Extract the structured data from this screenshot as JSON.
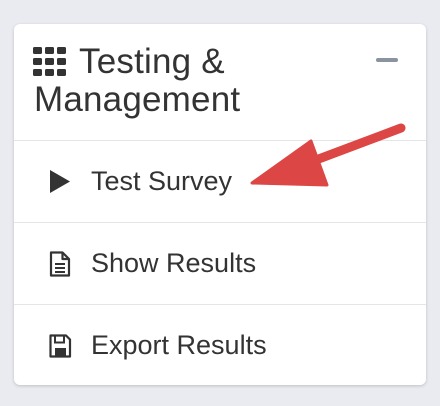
{
  "panel": {
    "title": "Testing & Management",
    "title_icon": "grid-icon",
    "collapse_icon": "minus-icon"
  },
  "menu": {
    "items": [
      {
        "label": "Test Survey",
        "icon": "play-icon"
      },
      {
        "label": "Show Results",
        "icon": "document-icon"
      },
      {
        "label": "Export Results",
        "icon": "floppy-disk-icon"
      }
    ]
  },
  "annotation": {
    "icon": "red-arrow-icon",
    "color": "#dc4644"
  },
  "colors": {
    "text": "#333333",
    "background": "#e9ebf0",
    "panel": "#ffffff",
    "divider": "#e3e5e9",
    "collapse": "#8b93a0"
  }
}
